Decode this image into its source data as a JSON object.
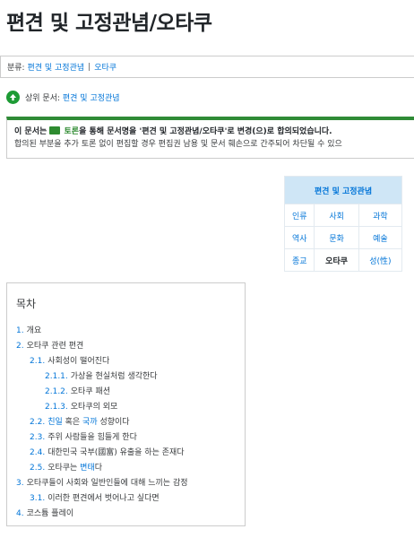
{
  "page": {
    "title": "편견 및 고정관념/오타쿠"
  },
  "category": {
    "label": "분류:",
    "links": [
      "편견 및 고정관념",
      "오타쿠"
    ],
    "separator": "|"
  },
  "parent_doc": {
    "label": "상위 문서:",
    "link": "편견 및 고정관념"
  },
  "notice": {
    "line1_prefix": "이 문서는 ",
    "discussion_link": "토론",
    "line1_suffix": "을 통해 문서명을 '편견 및 고정관념/오타쿠'로 변경(으)로 합의되었습니다.",
    "line2": "합의된 부분을 추가 토론 없이 편집할 경우 편집권 남용 및 문서 훼손으로 간주되어 차단될 수 있으"
  },
  "navbox": {
    "title": "편견 및 고정관념",
    "rows": [
      [
        "인류",
        "사회",
        "과학"
      ],
      [
        "역사",
        "문화",
        "예술"
      ],
      [
        "종교",
        "오타쿠",
        "성(性)"
      ]
    ],
    "current": "오타쿠"
  },
  "toc": {
    "title": "목차",
    "items": [
      {
        "num": "1.",
        "parts": [
          {
            "t": "개요"
          }
        ],
        "level": 1
      },
      {
        "num": "2.",
        "parts": [
          {
            "t": "오타쿠 관련 편견"
          }
        ],
        "level": 1
      },
      {
        "num": "2.1.",
        "parts": [
          {
            "t": "사회성이 떨어진다"
          }
        ],
        "level": 2
      },
      {
        "num": "2.1.1.",
        "parts": [
          {
            "t": "가상을 현실처럼 생각한다"
          }
        ],
        "level": 3
      },
      {
        "num": "2.1.2.",
        "parts": [
          {
            "t": "오타쿠 패션"
          }
        ],
        "level": 3
      },
      {
        "num": "2.1.3.",
        "parts": [
          {
            "t": "오타쿠의 외모"
          }
        ],
        "level": 3
      },
      {
        "num": "2.2.",
        "parts": [
          {
            "t": "친일",
            "link": true
          },
          {
            "t": " 혹은 "
          },
          {
            "t": "국까",
            "link": true
          },
          {
            "t": " 성향이다"
          }
        ],
        "level": 2
      },
      {
        "num": "2.3.",
        "parts": [
          {
            "t": "주위 사람들을 힘들게 한다"
          }
        ],
        "level": 2
      },
      {
        "num": "2.4.",
        "parts": [
          {
            "t": "대한민국 국부(國富) 유출을 하는 존재다"
          }
        ],
        "level": 2
      },
      {
        "num": "2.5.",
        "parts": [
          {
            "t": "오타쿠는 "
          },
          {
            "t": "변태",
            "link": true
          },
          {
            "t": "다"
          }
        ],
        "level": 2
      },
      {
        "num": "3.",
        "parts": [
          {
            "t": "오타쿠들이 사회와 일반인들에 대해 느끼는 감정"
          }
        ],
        "level": 1
      },
      {
        "num": "3.1.",
        "parts": [
          {
            "t": "이러한 편견에서 벗어나고 싶다면"
          }
        ],
        "level": 2
      },
      {
        "num": "4.",
        "parts": [
          {
            "t": "코스튬 플레이"
          }
        ],
        "level": 1
      }
    ]
  }
}
